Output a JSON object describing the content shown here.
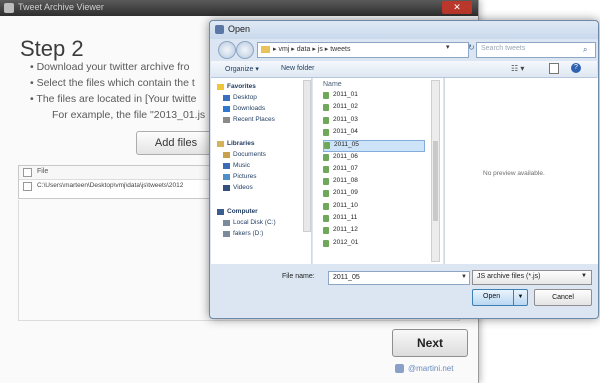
{
  "wizard": {
    "title": "Tweet Archive Viewer",
    "close_glyph": "✕",
    "step_title": "Step 2",
    "instructions": [
      "• Download your twitter archive fro",
      "• Select the files which contain the t",
      "• The files are located in [Your twitte",
      "For example, the file \"2013_01.js"
    ],
    "add_files_label": "Add files",
    "table": {
      "header": "File",
      "row": "C:\\Users\\marteen\\Desktop\\vmj\\data\\js\\tweets\\2012"
    },
    "next_label": "Next",
    "footer": "@martini.net"
  },
  "dialog": {
    "title": "Open",
    "address": "▸ vmj ▸ data ▸ js ▸ tweets",
    "search_placeholder": "Search tweets",
    "organize": "Organize ▾",
    "new_folder": "New folder",
    "views_glyph": "☷ ▾",
    "help_glyph": "?",
    "nav": {
      "favorites": "Favorites",
      "desktop": "Desktop",
      "downloads": "Downloads",
      "recent": "Recent Places",
      "libraries": "Libraries",
      "documents": "Documents",
      "music": "Music",
      "pictures": "Pictures",
      "videos": "Videos",
      "computer": "Computer",
      "local_disk": "Local Disk (C:)",
      "drive_d": "fakers (D:)"
    },
    "name_column": "Name",
    "files": [
      "2011_01",
      "2011_02",
      "2011_03",
      "2011_04",
      "2011_05",
      "2011_06",
      "2011_07",
      "2011_08",
      "2011_09",
      "2011_10",
      "2011_11",
      "2011_12",
      "2012_01"
    ],
    "selected_file": "2011_05",
    "no_preview": "No preview available.",
    "filename_label": "File name:",
    "filename_value": "2011_05",
    "filter": "JS archive files (*.js)",
    "open_label": "Open",
    "cancel_label": "Cancel"
  },
  "colors": {
    "selection": "#cde3f8",
    "dialog_frame": "#dbe6f2",
    "folder": "#e9c25a",
    "js_icon": "#6fa85a"
  }
}
